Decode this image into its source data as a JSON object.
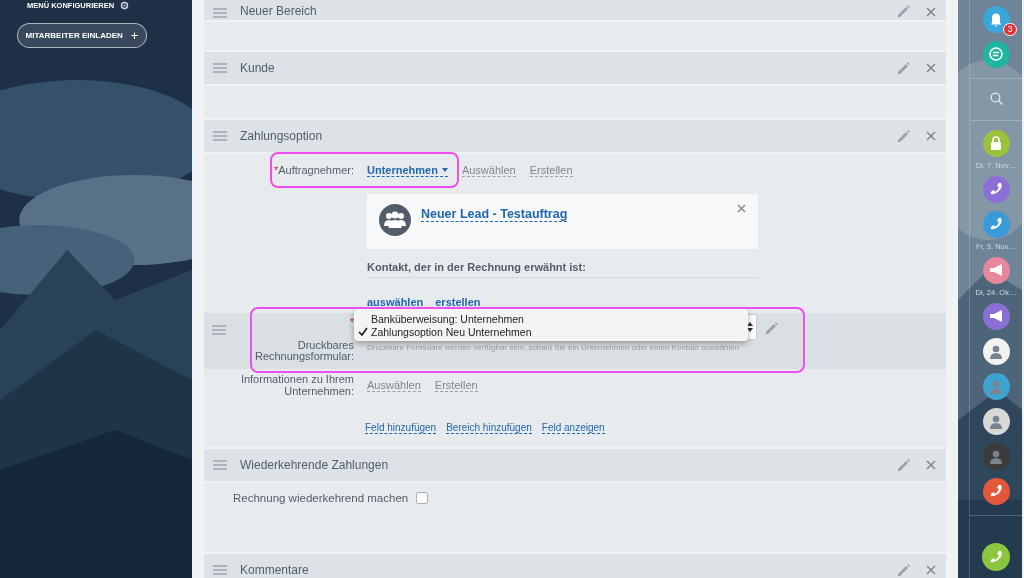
{
  "left_panel": {
    "menu_configure": "MENÜ KONFIGURIEREN",
    "invite_button": {
      "label": "MITARBEITER EINLADEN",
      "icon": "+"
    }
  },
  "sections": [
    {
      "kind": "empty",
      "title": "Neuer Bereich"
    },
    {
      "kind": "empty",
      "title": "Kunde"
    },
    {
      "kind": "payment",
      "title": "Zahlungsoption",
      "contractor": {
        "required_mark": "*",
        "label": "Auftragnehmer:",
        "value": "Unternehmen",
        "actions": [
          "Auswählen",
          "Erstellen"
        ],
        "highlighted": true
      },
      "card": {
        "title": "Neuer Lead - Testauftrag"
      },
      "contact": {
        "label": "Kontakt, der in der Rechnung erwähnt ist:",
        "actions": [
          "auswählen",
          "erstellen"
        ]
      },
      "invoice_form": {
        "required_mark": "*",
        "label": "Druckbares Rechnungsformular:",
        "highlighted": true,
        "options": [
          {
            "label": "Banküberweisung: Unternehmen",
            "selected": false
          },
          {
            "label": "Zahlungsoption Neu Unternehmen",
            "selected": true
          }
        ],
        "hint": "Druckbare Formulare werden verfügbar sein, sobald Sie ein Unternehmen oder einen Kontakt auswählen"
      },
      "company_info": {
        "label": "Informationen zu Ihrem Unternehmen:",
        "actions": [
          "Auswählen",
          "Erstellen"
        ]
      },
      "footer_links": [
        "Feld hinzufügen",
        "Bereich hinzufügen",
        "Feld anzeigen"
      ]
    },
    {
      "kind": "recurring",
      "title": "Wiederkehrende Zahlungen",
      "checkbox_label": "Rechnung wiederkehrend machen",
      "checked": false
    },
    {
      "kind": "empty",
      "title": "Kommentare"
    }
  ],
  "right_bar": {
    "items": [
      {
        "kind": "bell",
        "color": "#3aa7dc",
        "badge": "3"
      },
      {
        "kind": "chat",
        "color": "#1fb5a0"
      },
      {
        "kind": "divider"
      },
      {
        "kind": "search"
      },
      {
        "kind": "divider"
      },
      {
        "kind": "lock",
        "color": "#9cc13b"
      },
      {
        "kind": "date",
        "text": "Di, 7. Nov…"
      },
      {
        "kind": "phone",
        "color": "#8b6fd6"
      },
      {
        "kind": "phone",
        "color": "#3a9ad9"
      },
      {
        "kind": "date",
        "text": "Fr, 3. Nov…"
      },
      {
        "kind": "megaphone",
        "color": "#e8879b"
      },
      {
        "kind": "date",
        "text": "Di, 24. Ok…"
      },
      {
        "kind": "megaphone",
        "color": "#8b6fd6"
      },
      {
        "kind": "avatar",
        "color": "#f2f2f2"
      },
      {
        "kind": "avatar",
        "color": "#3fa3d1"
      },
      {
        "kind": "avatar",
        "color": "#d8d8d8"
      },
      {
        "kind": "avatar",
        "color": "#3b3b3b"
      },
      {
        "kind": "phone",
        "color": "#e4583a"
      },
      {
        "kind": "divider"
      },
      {
        "kind": "call",
        "color": "#8cc63f"
      }
    ]
  }
}
